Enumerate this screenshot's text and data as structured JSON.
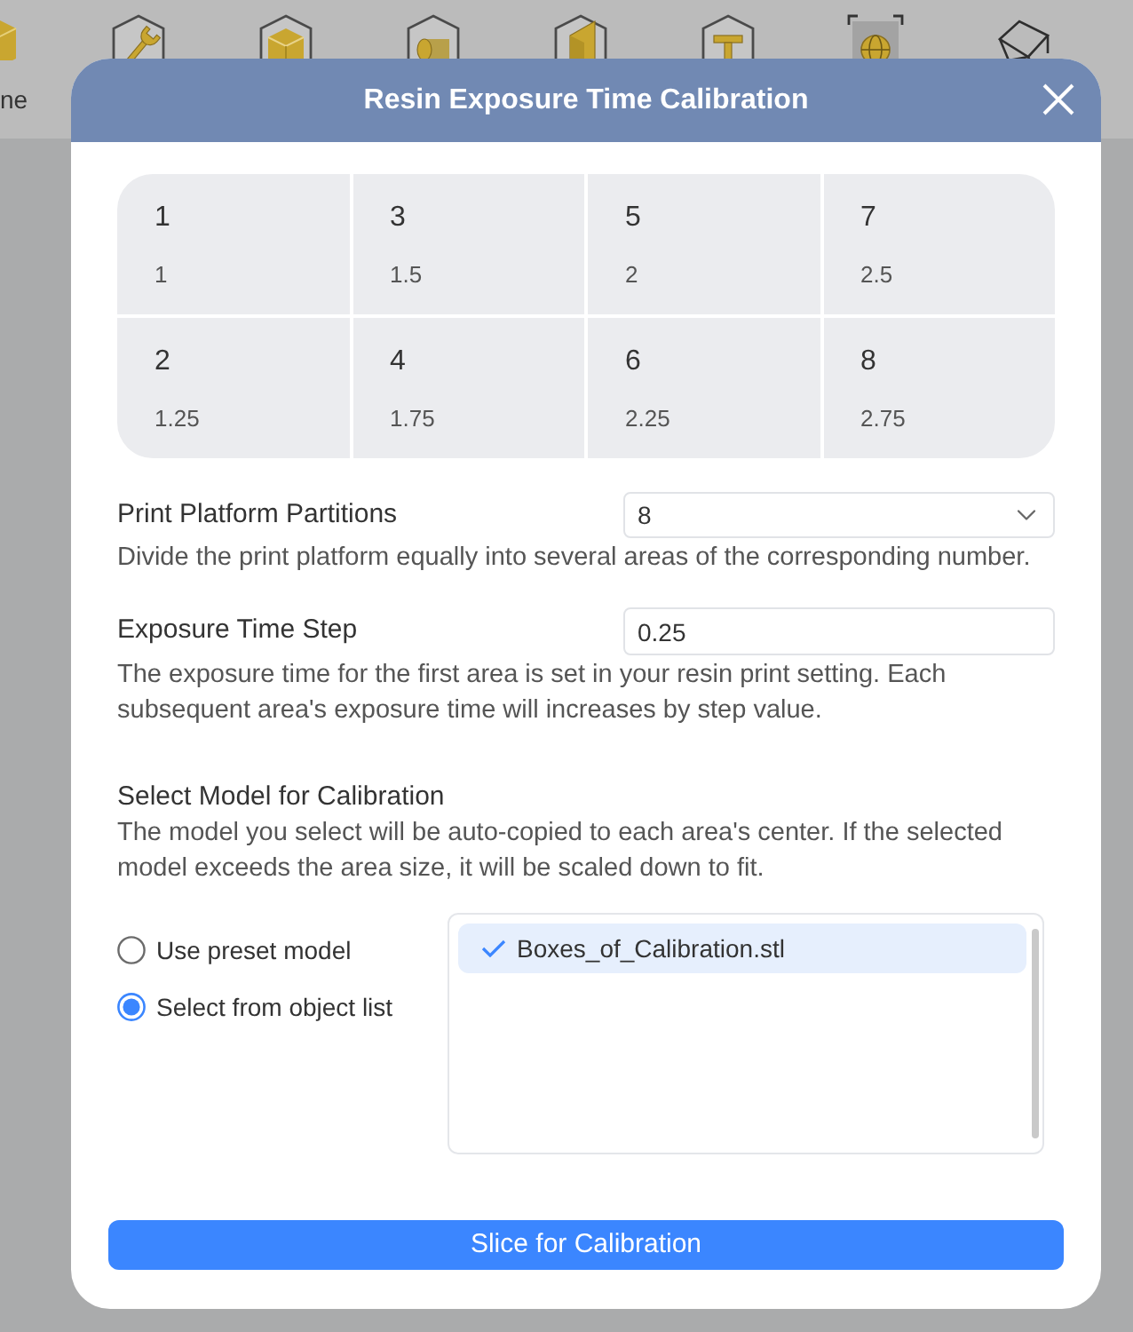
{
  "toolbar": {
    "tools": [
      {
        "kind": "cube",
        "label": "ne",
        "selected": false
      },
      {
        "kind": "wrench",
        "selected": false
      },
      {
        "kind": "box",
        "selected": false
      },
      {
        "kind": "cylinder",
        "selected": false
      },
      {
        "kind": "panel",
        "selected": false
      },
      {
        "kind": "t-beam",
        "selected": false
      },
      {
        "kind": "sphere",
        "selected": true
      },
      {
        "kind": "wireframe",
        "selected": false
      }
    ]
  },
  "dialog": {
    "title": "Resin Exposure Time Calibration",
    "areas": [
      {
        "number": "1",
        "time": "1"
      },
      {
        "number": "3",
        "time": "1.5"
      },
      {
        "number": "5",
        "time": "2"
      },
      {
        "number": "7",
        "time": "2.5"
      },
      {
        "number": "2",
        "time": "1.25"
      },
      {
        "number": "4",
        "time": "1.75"
      },
      {
        "number": "6",
        "time": "2.25"
      },
      {
        "number": "8",
        "time": "2.75"
      }
    ],
    "fields": [
      {
        "kind": "select",
        "label": "Print Platform Partitions",
        "value": "8",
        "description": "Divide the print platform equally into several areas of the corresponding number."
      },
      {
        "kind": "input",
        "label": "Exposure Time Step",
        "value": "0.25",
        "description": "The exposure time for the first area is set in your resin print setting. Each subsequent area's exposure time will increases by step value."
      }
    ],
    "model_section": {
      "title": "Select Model for Calibration",
      "description": "The model you select will be auto-copied to each area's center. If the selected model exceeds the area size, it will be scaled down to fit.",
      "options": [
        {
          "label": "Use preset model",
          "selected": false
        },
        {
          "label": "Select from object list",
          "selected": true
        }
      ],
      "models": [
        {
          "name": "Boxes_of_Calibration.stl",
          "selected": true
        }
      ]
    },
    "slice_button": "Slice for Calibration"
  }
}
